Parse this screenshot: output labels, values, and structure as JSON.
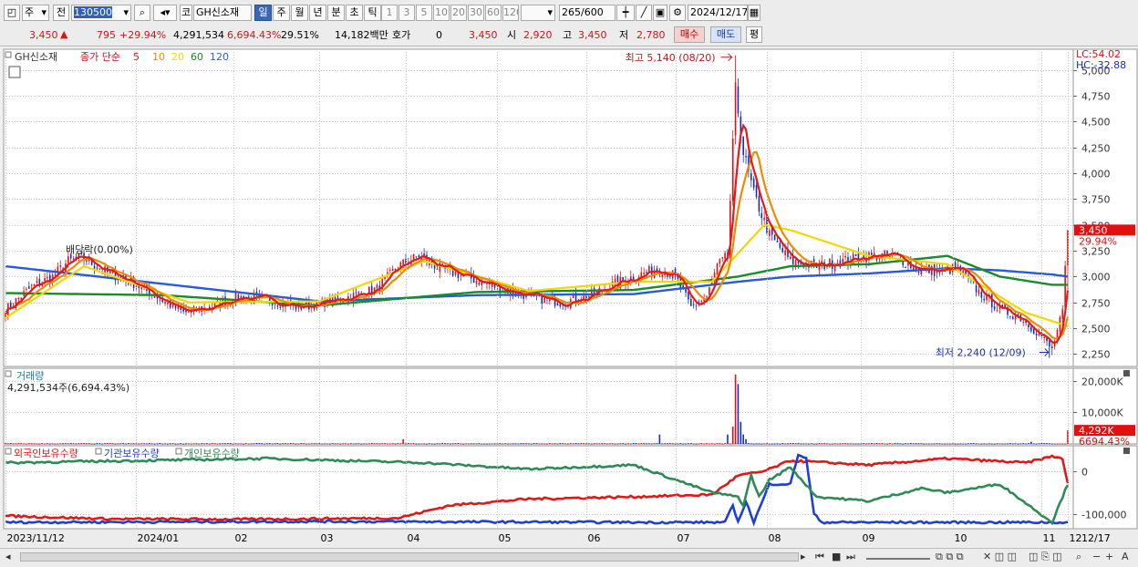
{
  "toolbar": {
    "period_label": "주",
    "prev_label": "전",
    "code_value": "130500",
    "code_prefix": "코",
    "stock_name": "GH신소재",
    "tabs": [
      "일",
      "주",
      "월",
      "년",
      "분",
      "초",
      "틱"
    ],
    "active_tab": "일",
    "intervals": [
      "1",
      "3",
      "5",
      "10",
      "20",
      "30",
      "60",
      "120"
    ],
    "count_value": "265",
    "count_total": "/600",
    "date_value": "2024/12/17"
  },
  "quote": {
    "price": "3,450",
    "change": "795",
    "change_pct": "+29.94%",
    "volume": "4,291,534",
    "volume_ratio": "6,694.43%",
    "turnover": "29.51%",
    "amount": "14,182백만",
    "hoga_label": "호가",
    "hoga_value": "0",
    "hoga_price": "3,450",
    "open_label": "시",
    "open": "2,920",
    "high_label": "고",
    "high": "3,450",
    "low_label": "저",
    "low": "2,780",
    "buy_label": "매수",
    "sell_label": "매도",
    "avg_label": "평"
  },
  "colors": {
    "up": "#e01010",
    "down": "#1030c0",
    "ma5": "#e31a1a",
    "ma10": "#f08a00",
    "ma20": "#f2d800",
    "ma60": "#1a8a2a",
    "ma120": "#2a5ad8",
    "foreign": "#e01818",
    "institution": "#1e3fd0",
    "individual": "#2e8b57"
  },
  "chart_data": [
    {
      "type": "candlestick",
      "legend": {
        "name": "GH신소재",
        "ma_label": "종가 단순",
        "periods": [
          "5",
          "10",
          "20",
          "60",
          "120"
        ]
      },
      "y_ticks": [
        "5,000",
        "4,750",
        "4,500",
        "4,250",
        "4,000",
        "3,750",
        "3,500",
        "3,250",
        "3,000",
        "2,750",
        "2,500",
        "2,250"
      ],
      "ylim": [
        2130,
        5200
      ],
      "x_ticks": [
        "2023/11/12",
        "2024/01",
        "02",
        "03",
        "04",
        "05",
        "06",
        "07",
        "08",
        "09",
        "10",
        "11",
        "12"
      ],
      "x_end": "12/17",
      "lc": "LC:54.02",
      "hc": "HC:-32.88",
      "last_price_tag": "3,450",
      "last_pct_tag": "29.94%",
      "annotations": {
        "high": "최고 5,140 (08/20)",
        "low": "최저 2,240 (12/09)",
        "dividend": "배당락(0.00%)"
      },
      "close_keypoints": [
        [
          0,
          2680
        ],
        [
          10,
          2900
        ],
        [
          18,
          3000
        ],
        [
          24,
          3150
        ],
        [
          30,
          3180
        ],
        [
          38,
          3050
        ],
        [
          48,
          2950
        ],
        [
          58,
          2800
        ],
        [
          68,
          2650
        ],
        [
          78,
          2700
        ],
        [
          88,
          2800
        ],
        [
          100,
          2780
        ],
        [
          112,
          2700
        ],
        [
          124,
          2760
        ],
        [
          134,
          2820
        ],
        [
          142,
          2880
        ],
        [
          150,
          3100
        ],
        [
          158,
          3200
        ],
        [
          166,
          3080
        ],
        [
          176,
          3000
        ],
        [
          190,
          2880
        ],
        [
          202,
          2800
        ],
        [
          212,
          2750
        ],
        [
          222,
          2800
        ],
        [
          230,
          2900
        ],
        [
          240,
          3000
        ],
        [
          250,
          3080
        ],
        [
          256,
          3000
        ],
        [
          262,
          2700
        ],
        [
          268,
          2800
        ],
        [
          272,
          3100
        ],
        [
          276,
          3200
        ],
        [
          279,
          4800
        ],
        [
          282,
          4200
        ],
        [
          286,
          3800
        ],
        [
          292,
          3400
        ],
        [
          300,
          3150
        ],
        [
          310,
          3100
        ],
        [
          320,
          3150
        ],
        [
          330,
          3200
        ],
        [
          340,
          3200
        ],
        [
          348,
          3080
        ],
        [
          356,
          3050
        ],
        [
          364,
          3080
        ],
        [
          372,
          2850
        ],
        [
          380,
          2680
        ],
        [
          388,
          2600
        ],
        [
          396,
          2420
        ],
        [
          400,
          2290
        ],
        [
          404,
          2660
        ],
        [
          406,
          3450
        ]
      ],
      "ma_keypoints": {
        "20": [
          [
            0,
            2600
          ],
          [
            30,
            3100
          ],
          [
            70,
            2750
          ],
          [
            120,
            2760
          ],
          [
            160,
            3150
          ],
          [
            200,
            2860
          ],
          [
            240,
            2950
          ],
          [
            270,
            2950
          ],
          [
            290,
            3500
          ],
          [
            300,
            3450
          ],
          [
            330,
            3200
          ],
          [
            360,
            3120
          ],
          [
            390,
            2650
          ],
          [
            406,
            2520
          ]
        ],
        "60": [
          [
            0,
            2840
          ],
          [
            60,
            2820
          ],
          [
            120,
            2720
          ],
          [
            180,
            2850
          ],
          [
            240,
            2870
          ],
          [
            280,
            3000
          ],
          [
            300,
            3100
          ],
          [
            330,
            3120
          ],
          [
            360,
            3200
          ],
          [
            380,
            3000
          ],
          [
            400,
            2920
          ],
          [
            406,
            2920
          ]
        ],
        "120": [
          [
            0,
            3100
          ],
          [
            60,
            2930
          ],
          [
            120,
            2760
          ],
          [
            180,
            2820
          ],
          [
            240,
            2830
          ],
          [
            280,
            2950
          ],
          [
            300,
            3000
          ],
          [
            330,
            3030
          ],
          [
            360,
            3080
          ],
          [
            380,
            3060
          ],
          [
            400,
            3020
          ],
          [
            406,
            3000
          ]
        ]
      }
    },
    {
      "type": "bar",
      "title": "거래량",
      "summary": "4,291,534주(6,694.43%)",
      "y_ticks": [
        "20,000K",
        "10,000K"
      ],
      "ylim": [
        0,
        24000
      ],
      "last_tag": "4,292K",
      "last_pct_tag": "6694.43%",
      "spikes": [
        [
          152,
          1500
        ],
        [
          250,
          3000
        ],
        [
          276,
          3000
        ],
        [
          278,
          5500
        ],
        [
          279,
          22000
        ],
        [
          280,
          19000
        ],
        [
          281,
          7000
        ],
        [
          282,
          3000
        ],
        [
          283,
          1500
        ],
        [
          392,
          700
        ],
        [
          406,
          4292
        ]
      ]
    },
    {
      "type": "line",
      "series": [
        {
          "name": "외국인보유수량",
          "keypoints": [
            [
              0,
              -105000
            ],
            [
              40,
              -112000
            ],
            [
              90,
              -113000
            ],
            [
              150,
              -110000
            ],
            [
              170,
              -80000
            ],
            [
              200,
              -65000
            ],
            [
              240,
              -60000
            ],
            [
              270,
              -55000
            ],
            [
              280,
              -10000
            ],
            [
              290,
              0
            ],
            [
              300,
              25000
            ],
            [
              330,
              15000
            ],
            [
              360,
              30000
            ],
            [
              390,
              20000
            ],
            [
              400,
              35000
            ],
            [
              404,
              30000
            ],
            [
              406,
              -30000
            ]
          ]
        },
        {
          "name": "기관보유수량",
          "keypoints": [
            [
              0,
              -120000
            ],
            [
              120,
              -118000
            ],
            [
              240,
              -120000
            ],
            [
              275,
              -120000
            ],
            [
              278,
              -80000
            ],
            [
              280,
              -120000
            ],
            [
              283,
              -70000
            ],
            [
              286,
              -120000
            ],
            [
              292,
              -30000
            ],
            [
              300,
              -30000
            ],
            [
              303,
              40000
            ],
            [
              306,
              30000
            ],
            [
              309,
              -100000
            ],
            [
              312,
              -120000
            ],
            [
              400,
              -120000
            ],
            [
              406,
              -120000
            ]
          ]
        },
        {
          "name": "개인보유수량",
          "keypoints": [
            [
              0,
              20000
            ],
            [
              100,
              30000
            ],
            [
              160,
              20000
            ],
            [
              200,
              5000
            ],
            [
              240,
              15000
            ],
            [
              270,
              -50000
            ],
            [
              280,
              -60000
            ],
            [
              282,
              -80000
            ],
            [
              285,
              -10000
            ],
            [
              288,
              -60000
            ],
            [
              292,
              -20000
            ],
            [
              300,
              10000
            ],
            [
              310,
              -60000
            ],
            [
              330,
              -70000
            ],
            [
              350,
              -40000
            ],
            [
              360,
              -50000
            ],
            [
              380,
              -30000
            ],
            [
              400,
              -120000
            ],
            [
              406,
              -30000
            ]
          ]
        }
      ],
      "y_ticks": [
        "0",
        "-100,000"
      ],
      "ylim": [
        -135000,
        60000
      ]
    }
  ]
}
